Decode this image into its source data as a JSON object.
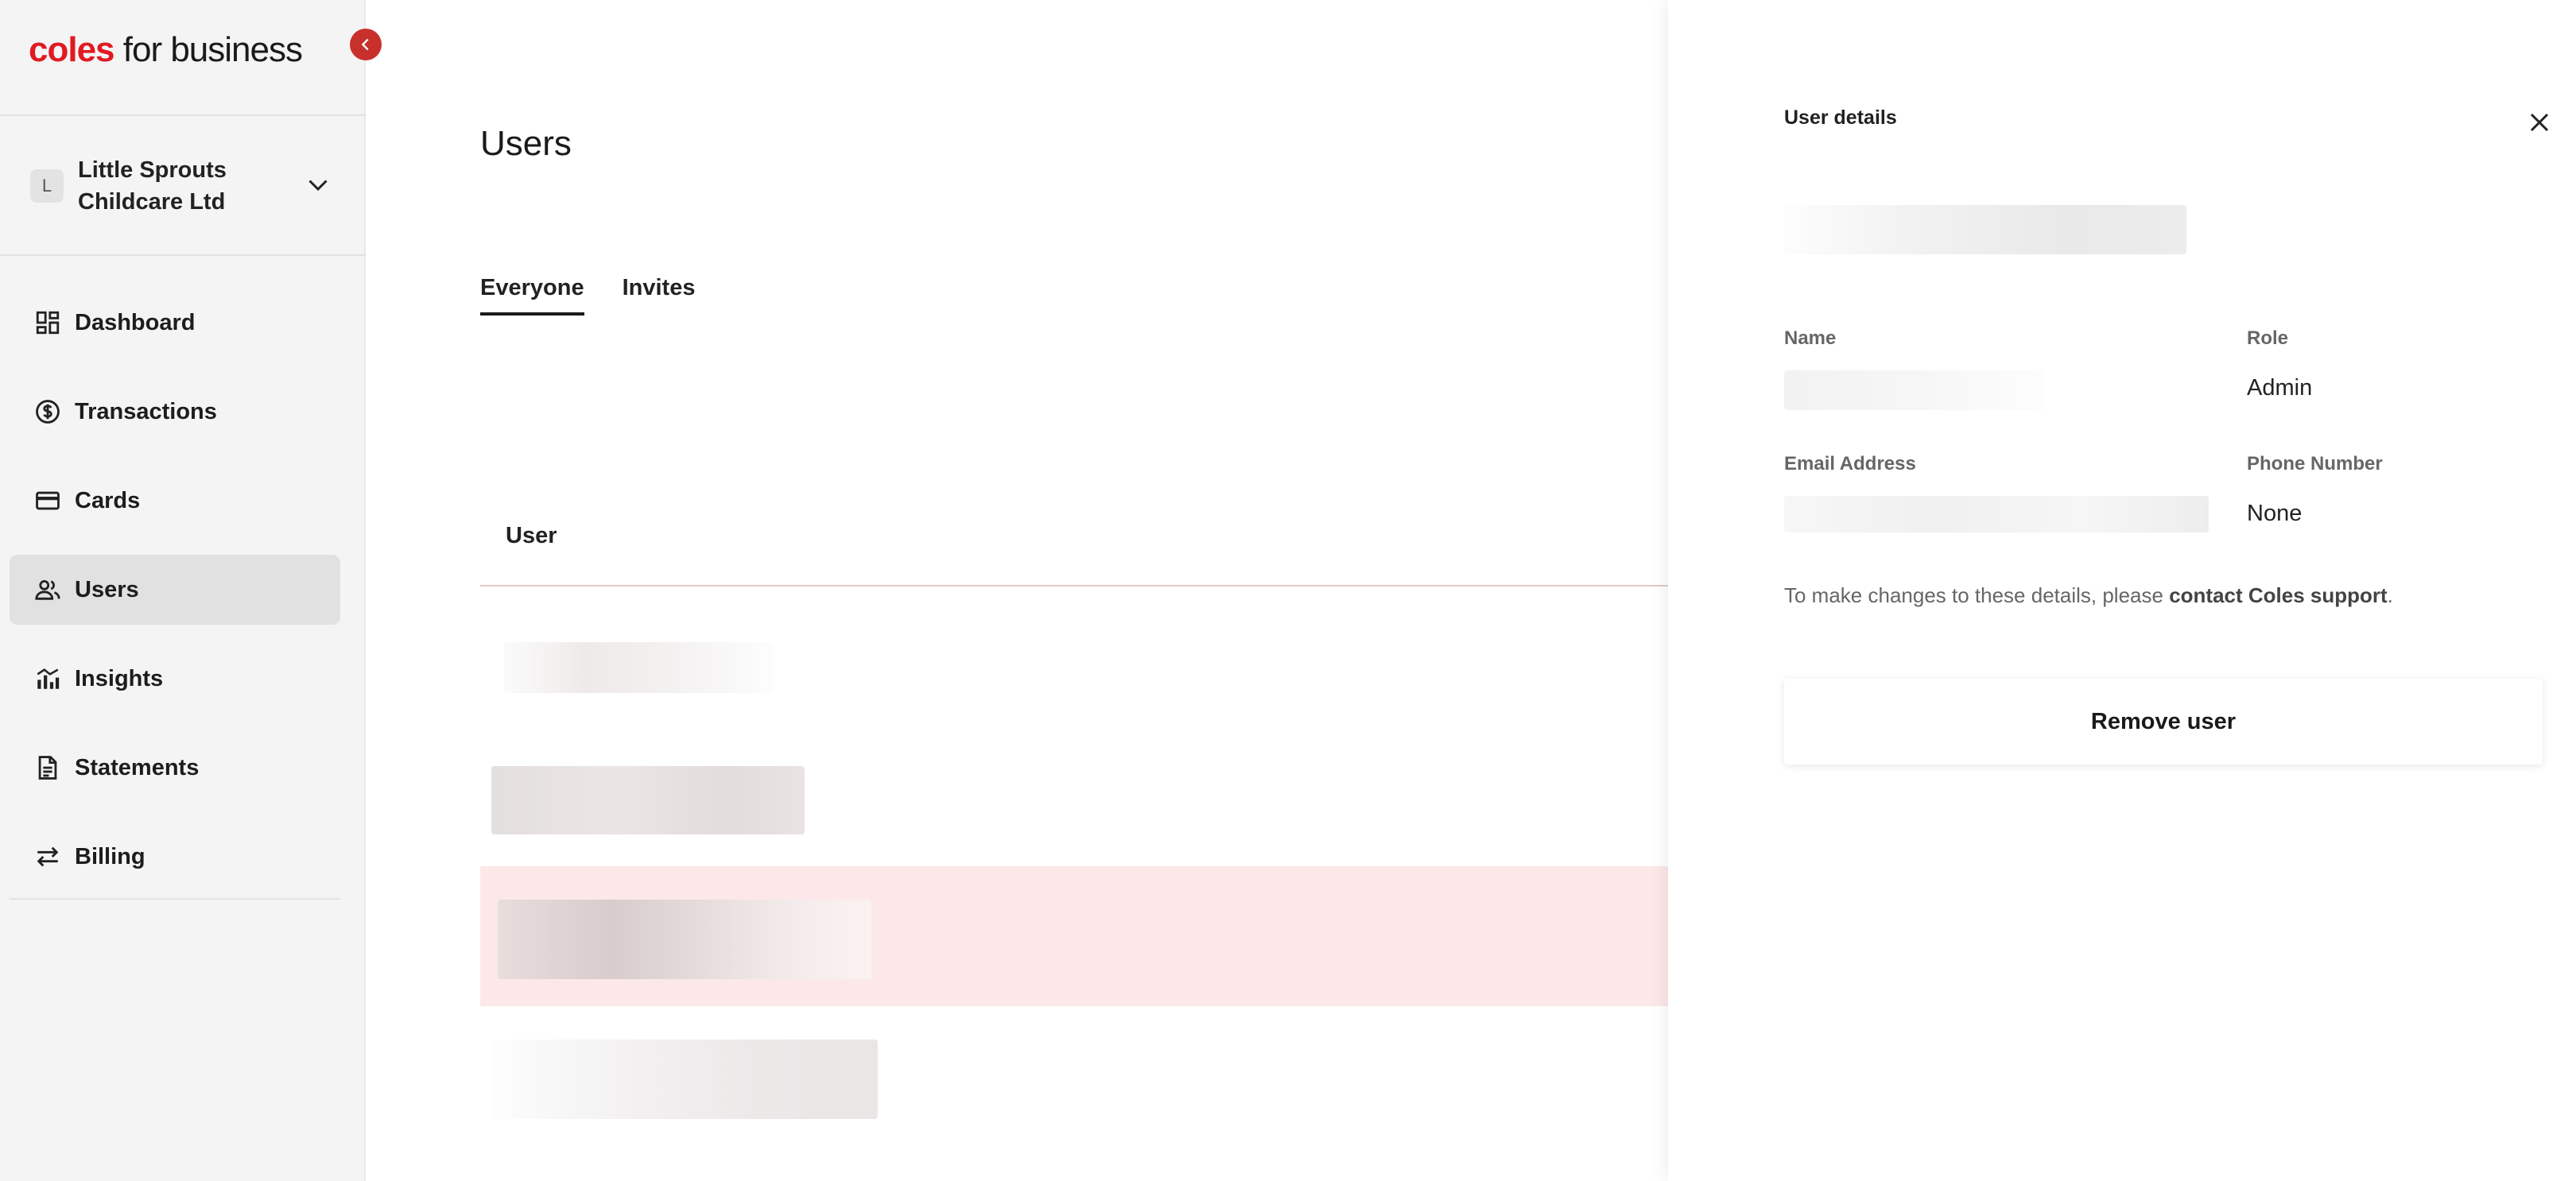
{
  "brand": {
    "name_primary": "coles",
    "name_secondary": "for business",
    "accent": "#e01a22"
  },
  "organization": {
    "initial": "L",
    "name": "Little Sprouts Childcare Ltd"
  },
  "nav": [
    {
      "label": "Dashboard",
      "icon": "dashboard-icon"
    },
    {
      "label": "Transactions",
      "icon": "dollar-circle-icon"
    },
    {
      "label": "Cards",
      "icon": "card-icon"
    },
    {
      "label": "Users",
      "icon": "users-icon",
      "active": true
    },
    {
      "label": "Insights",
      "icon": "chart-icon"
    },
    {
      "label": "Statements",
      "icon": "document-icon"
    },
    {
      "label": "Billing",
      "icon": "transfer-icon"
    }
  ],
  "main": {
    "title": "Users",
    "tabs": [
      {
        "label": "Everyone",
        "active": true
      },
      {
        "label": "Invites"
      }
    ],
    "table": {
      "header_user": "User"
    }
  },
  "drawer": {
    "title": "User details",
    "fields": {
      "name_label": "Name",
      "role_label": "Role",
      "role_value": "Admin",
      "email_label": "Email Address",
      "phone_label": "Phone Number",
      "phone_value": "None"
    },
    "note_prefix": "To make changes to these details, please ",
    "note_link": "contact Coles support",
    "note_suffix": ".",
    "remove_button": "Remove user"
  }
}
